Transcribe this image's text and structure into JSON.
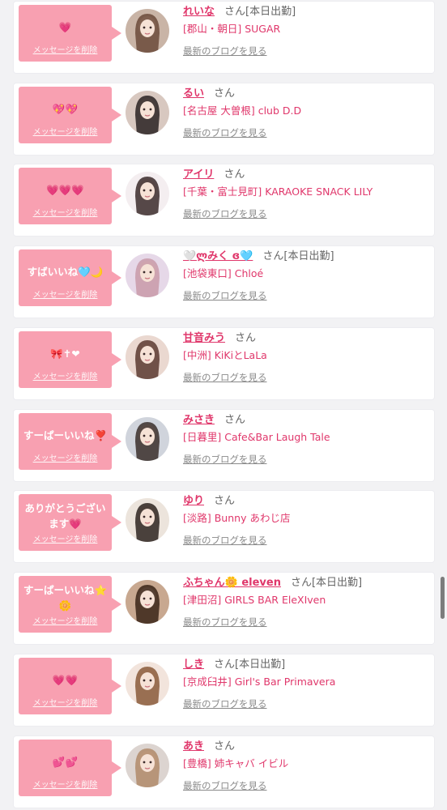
{
  "delete_label": "メッセージを削除",
  "san_label": "さん",
  "blog_label": "最新のブログを見る",
  "accent_color": "#e0376b",
  "bubble_color": "#f8a0b1",
  "items": [
    {
      "message": "💗",
      "name": "れいな",
      "working": "[本日出勤]",
      "shop": "[郡山・朝日] SUGAR"
    },
    {
      "message": "💖💖",
      "name": "るい",
      "working": "",
      "shop": "[名古屋 大曽根] club D.D"
    },
    {
      "message": "💗💗💗",
      "name": "アイリ",
      "working": "",
      "shop": "[千葉・富士見町] KARAOKE SNACK LILY"
    },
    {
      "message": "すばいいね🩵🌙",
      "name": "🤍ლみく ɞ🩵",
      "working": "[本日出勤]",
      "shop": "[池袋東口] Chloé"
    },
    {
      "message": "🎀✝❤",
      "name": "甘音みう",
      "working": "",
      "shop": "[中洲] KiKiとLaLa"
    },
    {
      "message": "すーぱーいいね❣️",
      "name": "みさき",
      "working": "",
      "shop": "[日暮里] Cafe&Bar Laugh Tale"
    },
    {
      "message": "ありがとうございます💗",
      "name": "ゆり",
      "working": "",
      "shop": "[淡路] Bunny あわじ店"
    },
    {
      "message": "すーぱーいいね⭐🌼",
      "name": "ふちゃん🌼 eleven",
      "working": "[本日出勤]",
      "shop": "[津田沼] GIRLS BAR EleXIven"
    },
    {
      "message": "💗💗",
      "name": "しき",
      "working": "[本日出勤]",
      "shop": "[京成臼井] Girl's Bar Primavera"
    },
    {
      "message": "💕💕",
      "name": "あき",
      "working": "",
      "shop": "[豊橋] 姉キャバ イビル"
    }
  ]
}
